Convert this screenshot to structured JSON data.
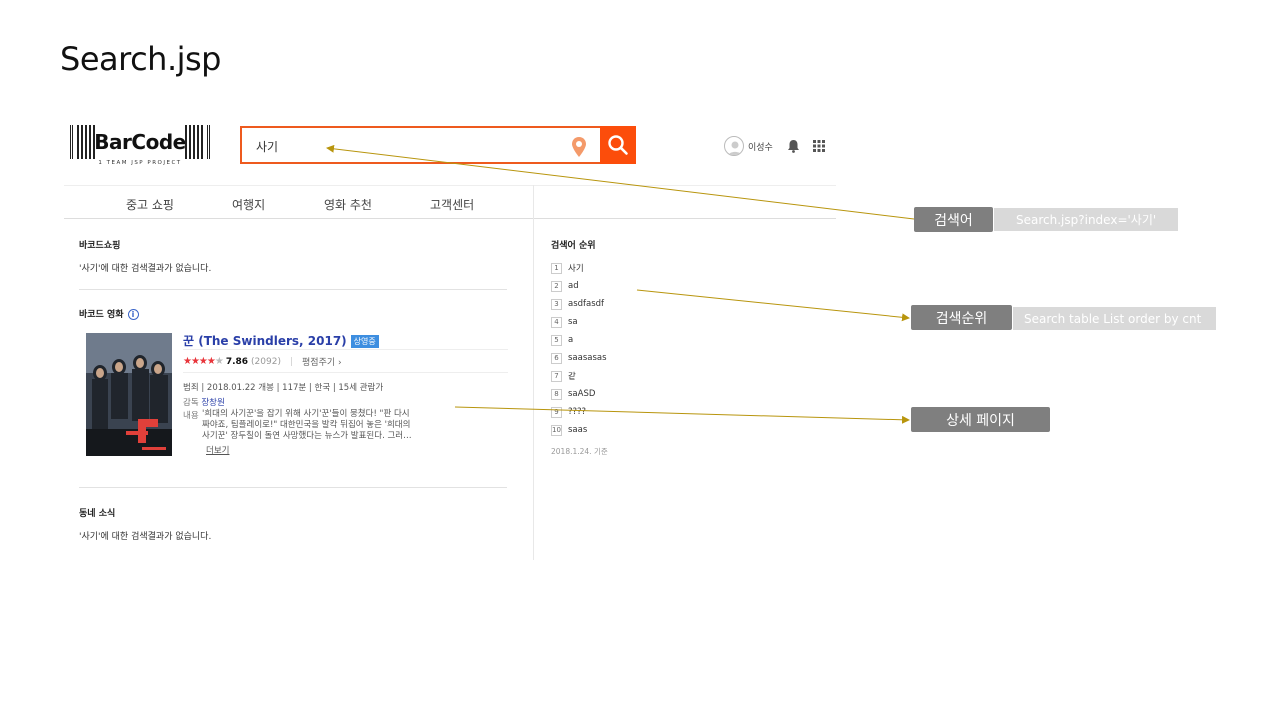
{
  "slide_title": "Search.jsp",
  "logo": {
    "text": "BarCode",
    "subtext": "1 TEAM JSP PROJECT"
  },
  "search": {
    "value": "사기"
  },
  "user": {
    "name": "이성수"
  },
  "nav": {
    "items": [
      "중고 쇼핑",
      "여행지",
      "영화 추천",
      "고객센터"
    ]
  },
  "sections": {
    "shopping": {
      "title": "바코드쇼핑",
      "empty_text": "'사기'에 대한 검색결과가 없습니다."
    },
    "movie": {
      "title": "바코드 영화",
      "info_icon": "i",
      "movie_title": "꾼 (The Swindlers, 2017)",
      "badge": "상영중",
      "stars": "★★★★",
      "star_empty": "★",
      "score": "7.86",
      "votes": "(2092)",
      "rate_link": "평점주기",
      "meta": "범죄 | 2018.01.22 개봉 | 117분 | 한국 | 15세 관람가",
      "director_label": "감독",
      "director": "장창원",
      "desc_label": "내용",
      "desc": "'희대의 사기꾼'을 잡기 위해 사기'꾼'들이 뭉쳤다! \"판 다시 짜야죠, 팀플레이로!\" 대한민국을 발칵 뒤집어 놓은 '희대의 사기꾼' 장두칠이 돌연 사망했다는 뉴스가 발표된다. 그러…",
      "more": "더보기"
    },
    "local": {
      "title": "동네 소식",
      "empty_text": "'사기'에 대한 검색결과가 없습니다."
    }
  },
  "ranking": {
    "title": "검색어 순위",
    "items": [
      "사기",
      "ad",
      "asdfasdf",
      "sa",
      "a",
      "saasasas",
      "같",
      "saASD",
      "????",
      "saas"
    ],
    "date": "2018.1.24. 기준"
  },
  "annotations": {
    "search_term": {
      "label": "검색어",
      "note": "Search.jsp?index='사기'"
    },
    "search_rank": {
      "label": "검색순위",
      "note": "Search table List order by cnt"
    },
    "detail_page": {
      "label": "상세 페이지"
    }
  },
  "colors": {
    "accent": "#fc4d0b",
    "annotation": "#7f7f7f",
    "arrow": "#b8950d"
  }
}
